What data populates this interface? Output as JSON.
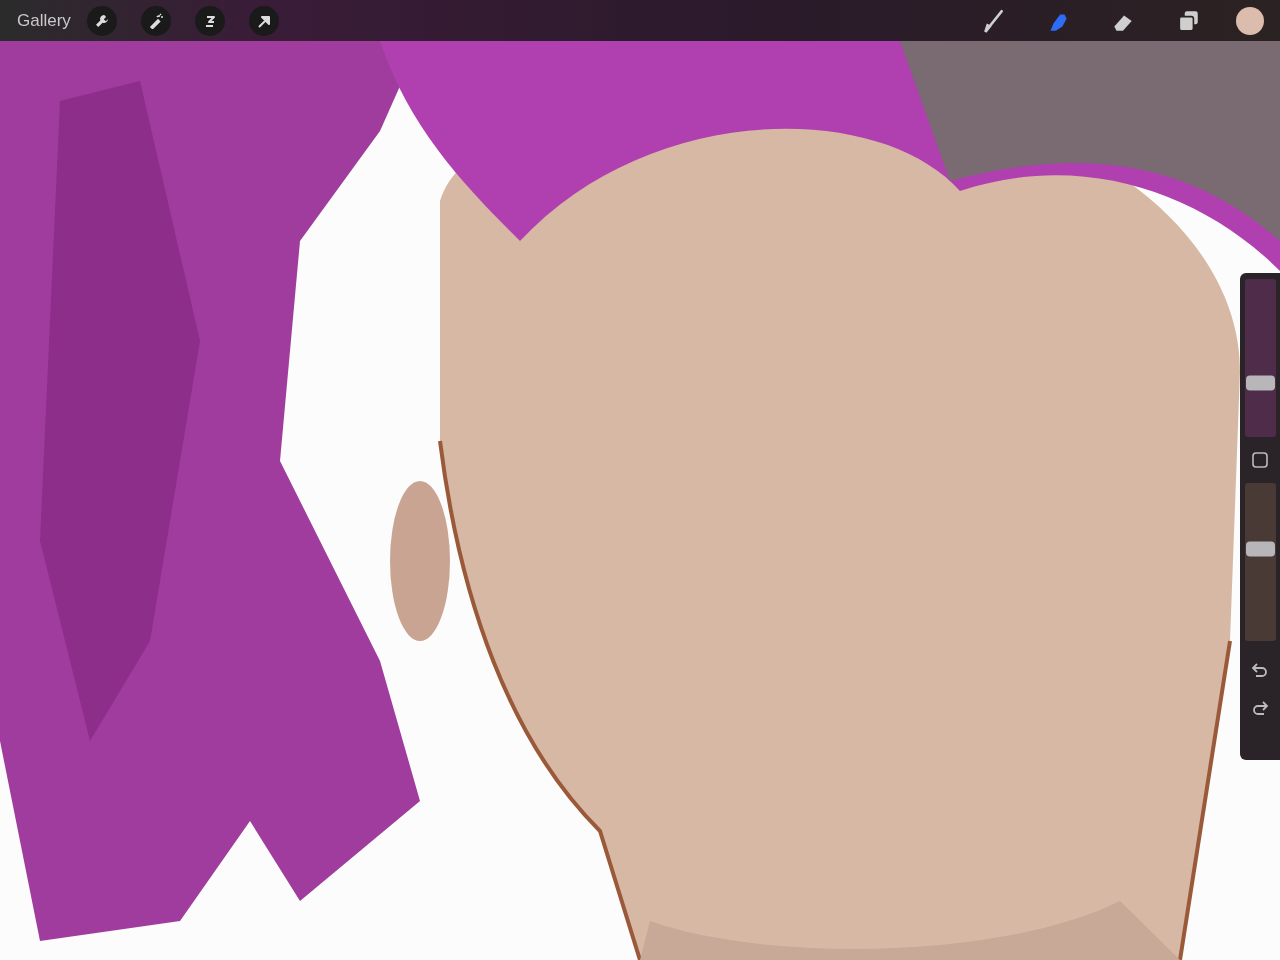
{
  "toolbar": {
    "gallery": "Gallery",
    "actions": [
      {
        "kind": "wrench"
      },
      {
        "kind": "wand"
      },
      {
        "kind": "selection"
      },
      {
        "kind": "arrow"
      }
    ],
    "tools": [
      {
        "kind": "brush",
        "selected": false
      },
      {
        "kind": "smudge",
        "selected": true
      },
      {
        "kind": "eraser",
        "selected": false
      },
      {
        "kind": "layers",
        "selected": false
      }
    ],
    "swatch": {
      "color": "#dcbcac"
    }
  },
  "sidebar": {
    "sliders": [
      {
        "kind": "size",
        "level": 0.34
      },
      {
        "kind": "opacity",
        "level": 0.58
      }
    ]
  }
}
